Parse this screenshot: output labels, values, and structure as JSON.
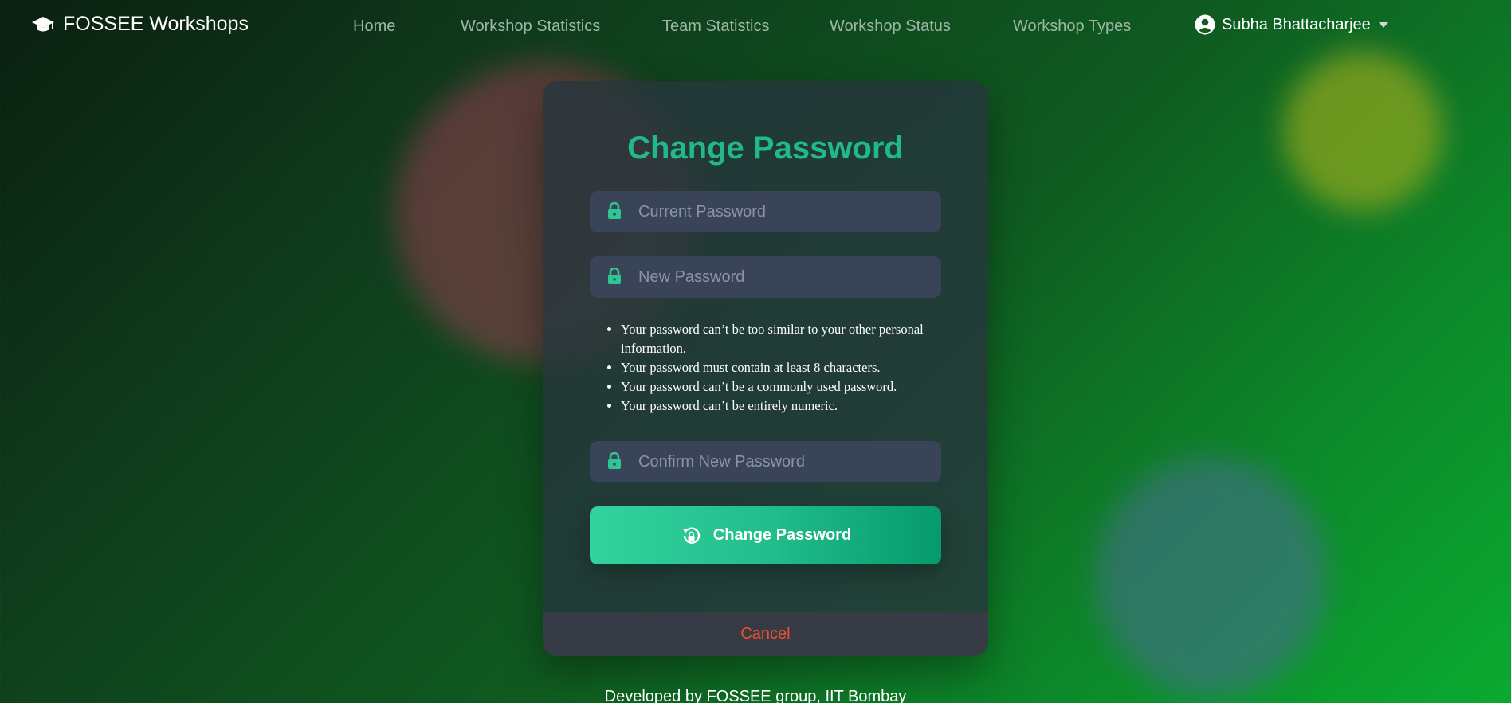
{
  "navbar": {
    "brand": "FOSSEE Workshops",
    "brand_icon": "graduation-cap-icon",
    "links": [
      {
        "label": "Home"
      },
      {
        "label": "Workshop Statistics"
      },
      {
        "label": "Team Statistics"
      },
      {
        "label": "Workshop Status"
      },
      {
        "label": "Workshop Types"
      }
    ],
    "user": {
      "name": "Subha Bhattacharjee",
      "icon": "user-circle-icon"
    }
  },
  "form": {
    "title": "Change Password",
    "current_password": {
      "placeholder": "Current Password",
      "value": ""
    },
    "new_password": {
      "placeholder": "New Password",
      "value": ""
    },
    "rules": [
      "Your password can’t be too similar to your other personal information.",
      "Your password must contain at least 8 characters.",
      "Your password can’t be a commonly used password.",
      "Your password can’t be entirely numeric."
    ],
    "confirm_password": {
      "placeholder": "Confirm New Password",
      "value": ""
    },
    "submit_label": "Change Password",
    "submit_icon": "lock-reset-icon",
    "cancel_label": "Cancel"
  },
  "footer": {
    "text": "Developed by FOSSEE group, IIT Bombay"
  },
  "colors": {
    "accent": "#21b989",
    "cancel": "#ee5227",
    "field_bg": "#3a4459"
  }
}
